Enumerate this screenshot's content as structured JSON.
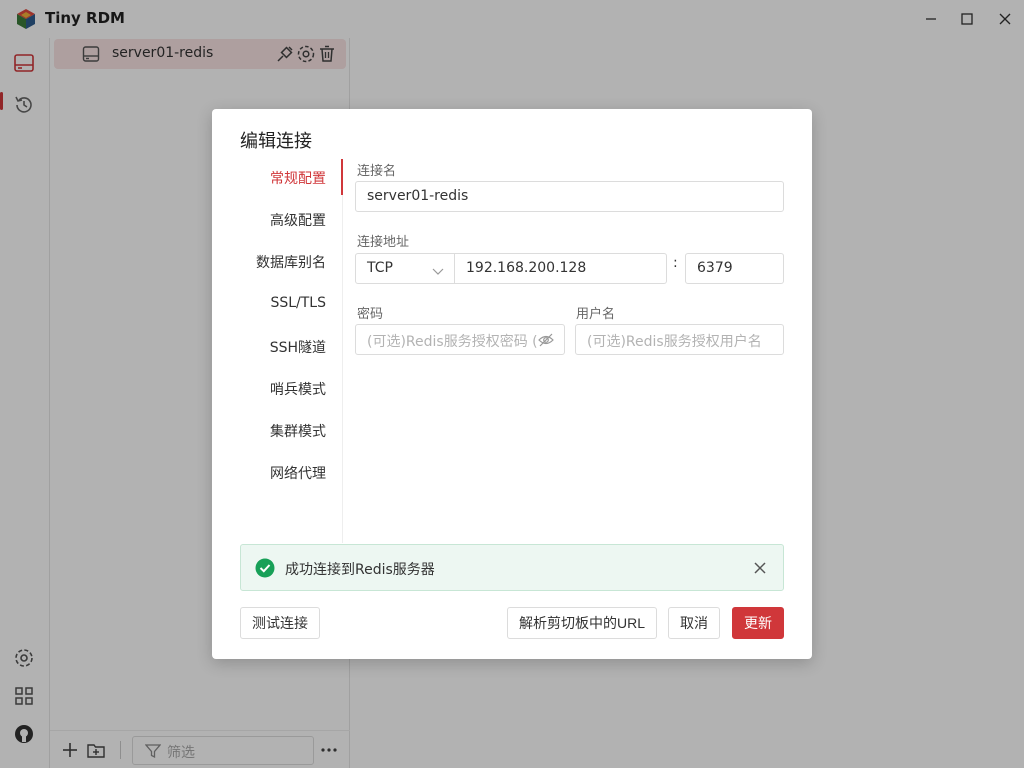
{
  "app": {
    "title": "Tiny RDM"
  },
  "connections": [
    {
      "name": "server01-redis"
    }
  ],
  "pane": {
    "filter_placeholder": "筛选"
  },
  "dialog": {
    "title": "编辑连接",
    "tabs": [
      "常规配置",
      "高级配置",
      "数据库别名",
      "SSL/TLS",
      "SSH隧道",
      "哨兵模式",
      "集群模式",
      "网络代理"
    ],
    "active_tab": 0,
    "fields": {
      "name_label": "连接名",
      "name_value": "server01-redis",
      "addr_label": "连接地址",
      "protocol": "TCP",
      "host": "192.168.200.128",
      "colon": ":",
      "port": "6379",
      "password_label": "密码",
      "password_placeholder": "(可选)Redis服务授权密码 (",
      "username_label": "用户名",
      "username_placeholder": "(可选)Redis服务授权用户名"
    },
    "alert": {
      "text": "成功连接到Redis服务器",
      "type": "success"
    },
    "buttons": {
      "test": "测试连接",
      "parse_url": "解析剪切板中的URL",
      "cancel": "取消",
      "update": "更新"
    }
  },
  "colors": {
    "accent": "#d0373a",
    "success": "#18a058"
  }
}
